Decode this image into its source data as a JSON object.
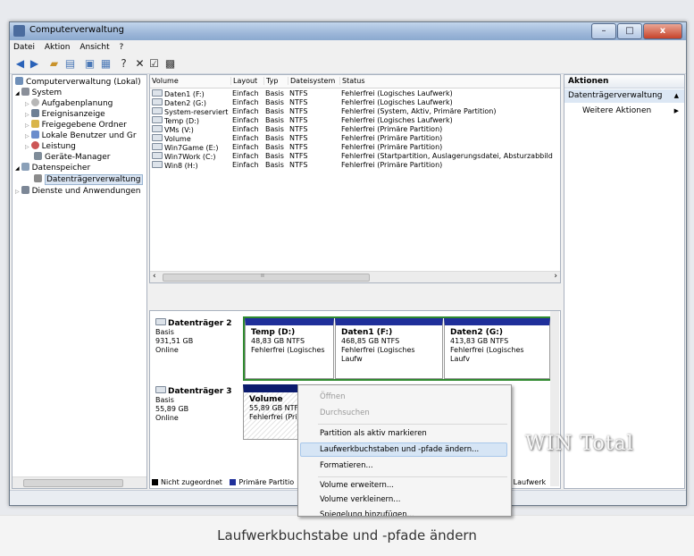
{
  "window": {
    "title": "Computerverwaltung",
    "minimize": "–",
    "maximize": "□",
    "close": "x"
  },
  "menu": [
    "Datei",
    "Aktion",
    "Ansicht",
    "?"
  ],
  "tree": [
    {
      "label": "Computerverwaltung (Lokal)",
      "level": 0
    },
    {
      "label": "System",
      "level": 1,
      "expander": "◢"
    },
    {
      "label": "Aufgabenplanung",
      "level": 2,
      "expander": "▷"
    },
    {
      "label": "Ereignisanzeige",
      "level": 2,
      "expander": "▷"
    },
    {
      "label": "Freigegebene Ordner",
      "level": 2,
      "expander": "▷"
    },
    {
      "label": "Lokale Benutzer und Gr",
      "level": 2,
      "expander": "▷"
    },
    {
      "label": "Leistung",
      "level": 2,
      "expander": "▷"
    },
    {
      "label": "Geräte-Manager",
      "level": 2
    },
    {
      "label": "Datenspeicher",
      "level": 1,
      "expander": "◢"
    },
    {
      "label": "Datenträgerverwaltung",
      "level": 2,
      "selected": true
    },
    {
      "label": "Dienste und Anwendungen",
      "level": 1,
      "expander": "▷"
    }
  ],
  "volumes": {
    "headers": [
      "Volume",
      "Layout",
      "Typ",
      "Dateisystem",
      "Status"
    ],
    "rows": [
      [
        "Daten1 (F:)",
        "Einfach",
        "Basis",
        "NTFS",
        "Fehlerfrei (Logisches Laufwerk)"
      ],
      [
        "Daten2 (G:)",
        "Einfach",
        "Basis",
        "NTFS",
        "Fehlerfrei (Logisches Laufwerk)"
      ],
      [
        "System-reserviert",
        "Einfach",
        "Basis",
        "NTFS",
        "Fehlerfrei (System, Aktiv, Primäre Partition)"
      ],
      [
        "Temp (D:)",
        "Einfach",
        "Basis",
        "NTFS",
        "Fehlerfrei (Logisches Laufwerk)"
      ],
      [
        "VMs (V:)",
        "Einfach",
        "Basis",
        "NTFS",
        "Fehlerfrei (Primäre Partition)"
      ],
      [
        "Volume",
        "Einfach",
        "Basis",
        "NTFS",
        "Fehlerfrei (Primäre Partition)"
      ],
      [
        "Win7Game (E:)",
        "Einfach",
        "Basis",
        "NTFS",
        "Fehlerfrei (Primäre Partition)"
      ],
      [
        "Win7Work (C:)",
        "Einfach",
        "Basis",
        "NTFS",
        "Fehlerfrei (Startpartition, Auslagerungsdatei, Absturzabbild"
      ],
      [
        "Win8 (H:)",
        "Einfach",
        "Basis",
        "NTFS",
        "Fehlerfrei (Primäre Partition)"
      ]
    ],
    "scroll_left": "‹",
    "scroll_mid": "ıı",
    "scroll_right": "›"
  },
  "disks": [
    {
      "name": "Datenträger 2",
      "type": "Basis",
      "size": "931,51 GB",
      "state": "Online",
      "partitions": [
        {
          "name": "Temp  (D:)",
          "size": "48,83 GB NTFS",
          "status": "Fehlerfrei (Logisches"
        },
        {
          "name": "Daten1  (F:)",
          "size": "468,85 GB NTFS",
          "status": "Fehlerfrei (Logisches Laufw"
        },
        {
          "name": "Daten2  (G:)",
          "size": "413,83 GB NTFS",
          "status": "Fehlerfrei (Logisches Laufv"
        }
      ]
    },
    {
      "name": "Datenträger 3",
      "type": "Basis",
      "size": "55,89 GB",
      "state": "Online",
      "partitions": [
        {
          "name": "Volume",
          "size": "55,89 GB NTFS",
          "status": "Fehlerfrei (Prim"
        }
      ]
    }
  ],
  "legend": {
    "unallocated": "Nicht zugeordnet",
    "primary": "Primäre Partitio",
    "logical": "es Laufwerk"
  },
  "actions": {
    "header": "Aktionen",
    "section": "Datenträgerverwaltung",
    "item": "Weitere Aktionen"
  },
  "context_menu": [
    {
      "label": "Öffnen",
      "disabled": true
    },
    {
      "label": "Durchsuchen",
      "disabled": true
    },
    {
      "label": "Partition als aktiv markieren"
    },
    {
      "label": "Laufwerkbuchstaben und -pfade ändern...",
      "highlighted": true
    },
    {
      "label": "Formatieren..."
    },
    {
      "label": "Volume erweitern..."
    },
    {
      "label": "Volume verkleinern..."
    },
    {
      "label": "Spiegelung hinzufügen..."
    }
  ],
  "watermark": "WIN Total",
  "caption": "Laufwerkbuchstabe und -pfade ändern",
  "colors": {
    "primary": "#1f2f9a",
    "logical": "#2f8a2f",
    "selection": "#d6e5f5",
    "unallocated": "#000000"
  }
}
